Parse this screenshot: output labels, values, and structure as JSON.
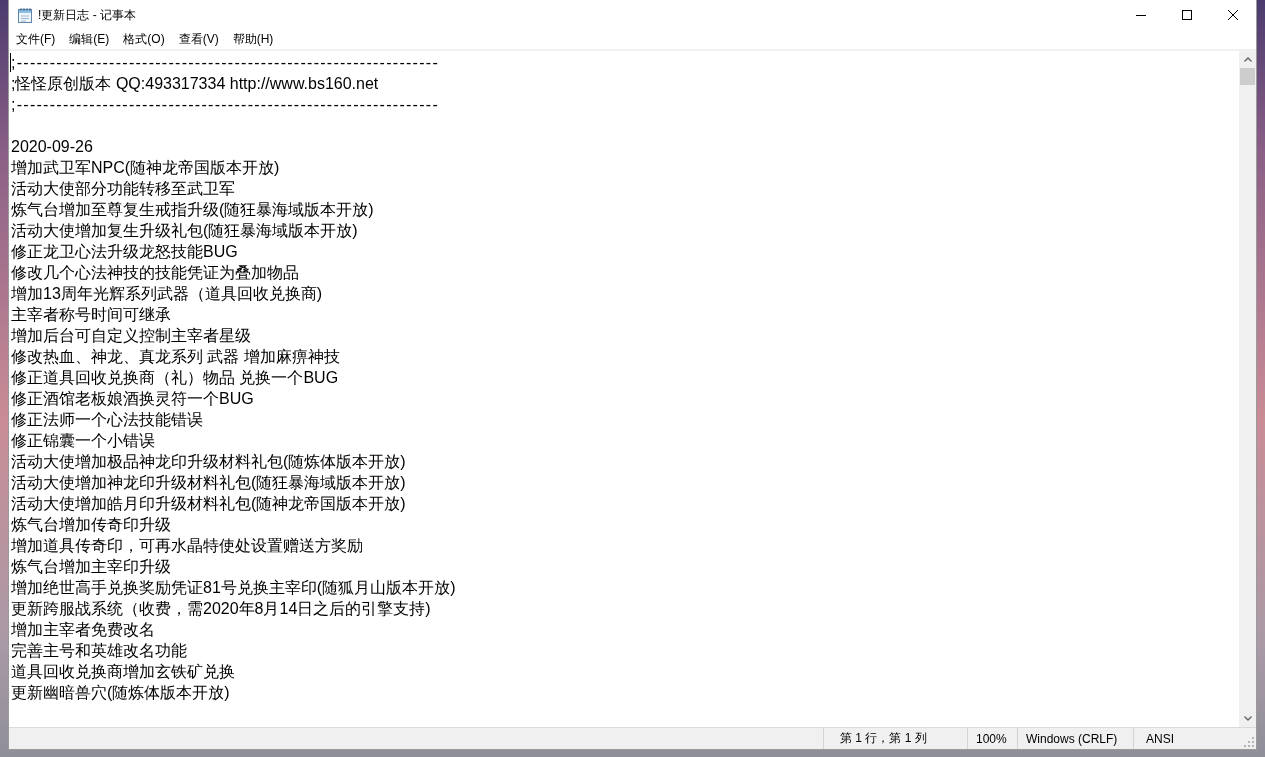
{
  "window": {
    "title": "!更新日志 - 记事本"
  },
  "menu": [
    "文件(F)",
    "编辑(E)",
    "格式(O)",
    "查看(V)",
    "帮助(H)"
  ],
  "editor": {
    "header_lines": [
      {
        "kind": "rule",
        "text": ";----------------------------------------------------------------"
      },
      {
        "kind": "text",
        "text": ";怪怪原创版本 QQ:493317334 http://www.bs160.net"
      },
      {
        "kind": "rule",
        "text": ";----------------------------------------------------------------"
      }
    ],
    "changelog": {
      "date": "2020-09-26",
      "entries": [
        "增加武卫军NPC(随神龙帝国版本开放)",
        "活动大使部分功能转移至武卫军",
        "炼气台增加至尊复生戒指升级(随狂暴海域版本开放)",
        "活动大使增加复生升级礼包(随狂暴海域版本开放)",
        "修正龙卫心法升级龙怒技能BUG",
        "修改几个心法神技的技能凭证为叠加物品",
        "增加13周年光辉系列武器（道具回收兑换商)",
        "主宰者称号时间可继承",
        "增加后台可自定义控制主宰者星级",
        "修改热血、神龙、真龙系列 武器 增加麻痹神技",
        "修正道具回收兑换商（礼）物品 兑换一个BUG",
        "修正酒馆老板娘酒换灵符一个BUG",
        "修正法师一个心法技能错误",
        "修正锦囊一个小错误",
        "活动大使增加极品神龙印升级材料礼包(随炼体版本开放)",
        "活动大使增加神龙印升级材料礼包(随狂暴海域版本开放)",
        "活动大使增加皓月印升级材料礼包(随神龙帝国版本开放)",
        "炼气台增加传奇印升级",
        "增加道具传奇印，可再水晶特使处设置赠送方奖励",
        "炼气台增加主宰印升级",
        "增加绝世高手兑换奖励凭证81号兑换主宰印(随狐月山版本开放)",
        "更新跨服战系统（收费，需2020年8月14日之后的引擎支持)",
        "增加主宰者免费改名",
        "完善主号和英雄改名功能",
        "道具回收兑换商增加玄铁矿兑换",
        "更新幽暗兽穴(随炼体版本开放)"
      ]
    }
  },
  "status_bar": {
    "position": "第 1 行，第 1 列",
    "zoom": "100%",
    "line_ending": "Windows (CRLF)",
    "encoding": "ANSI"
  }
}
